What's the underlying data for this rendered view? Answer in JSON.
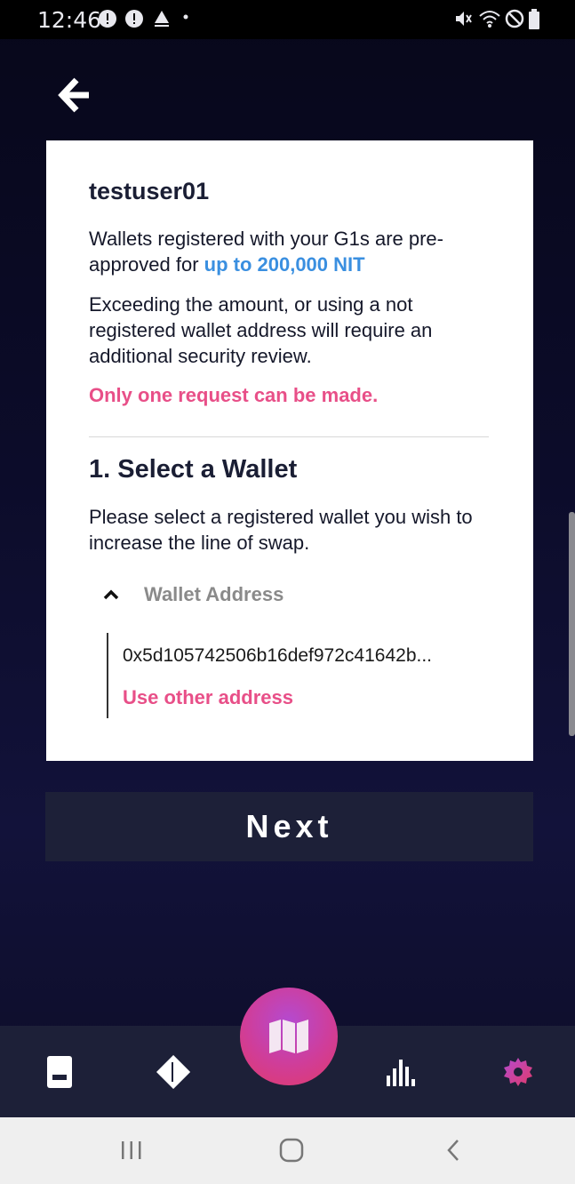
{
  "status_bar": {
    "time": "12:46",
    "left_icons": [
      "alert-icon",
      "alert-icon",
      "notification-icon",
      "dot-icon"
    ],
    "right_icons": [
      "mute-icon",
      "wifi-icon",
      "dnd-icon",
      "battery-icon"
    ]
  },
  "header": {
    "back_icon": "arrow-left-icon"
  },
  "card": {
    "username": "testuser01",
    "preapproval_text": "Wallets registered with your G1s are pre-approved for ",
    "preapproval_amount": "up to 200,000 NIT",
    "review_text": "Exceeding the amount, or using a not registered wallet address will require an additional security review.",
    "warning": "Only one request can be made.",
    "step_title": "1. Select a Wallet",
    "step_description": "Please select a registered wallet you wish to increase the line of swap.",
    "wallet_label": "Wallet Address",
    "wallet_address": "0x5d105742506b16def972c41642b...",
    "other_address_link": "Use other address"
  },
  "next_button": {
    "label": "Next"
  },
  "tab_bar": {
    "items": [
      {
        "icon": "wallet-icon",
        "active": false
      },
      {
        "icon": "tag-icon",
        "active": false
      },
      {
        "icon": "map-icon",
        "active": true
      },
      {
        "icon": "chart-icon",
        "active": false
      },
      {
        "icon": "settings-gear-icon",
        "active": false
      }
    ],
    "accent": "#d03d98"
  },
  "nav_bar": {
    "icons": [
      "recents-icon",
      "home-icon",
      "back-icon"
    ]
  },
  "colors": {
    "background": "#0c0c2a",
    "card": "#ffffff",
    "link_blue": "#3a8fe0",
    "pink": "#e84f88",
    "button_bg": "#1d2038"
  }
}
